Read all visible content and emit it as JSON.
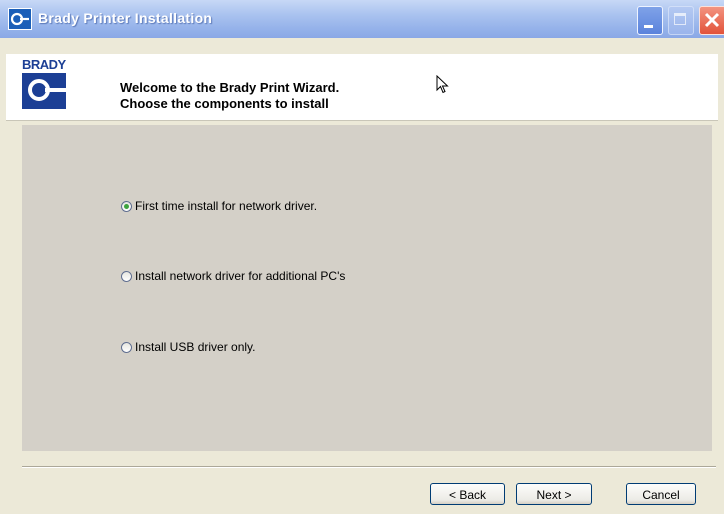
{
  "window": {
    "title": "Brady Printer Installation"
  },
  "header": {
    "logo_text": "BRADY",
    "title_line1": "Welcome to the Brady Print Wizard.",
    "title_line2": "Choose the components to install"
  },
  "options": [
    {
      "label": "First time install for network driver.",
      "checked": true
    },
    {
      "label": "Install network driver for additional PC's",
      "checked": false
    },
    {
      "label": "Install USB driver only.",
      "checked": false
    }
  ],
  "buttons": {
    "back": "< Back",
    "next": "Next >",
    "cancel": "Cancel"
  },
  "colors": {
    "titlebar": "#95b2ea",
    "brand": "#1c3f95",
    "radio_selected": "#3ea33e"
  }
}
